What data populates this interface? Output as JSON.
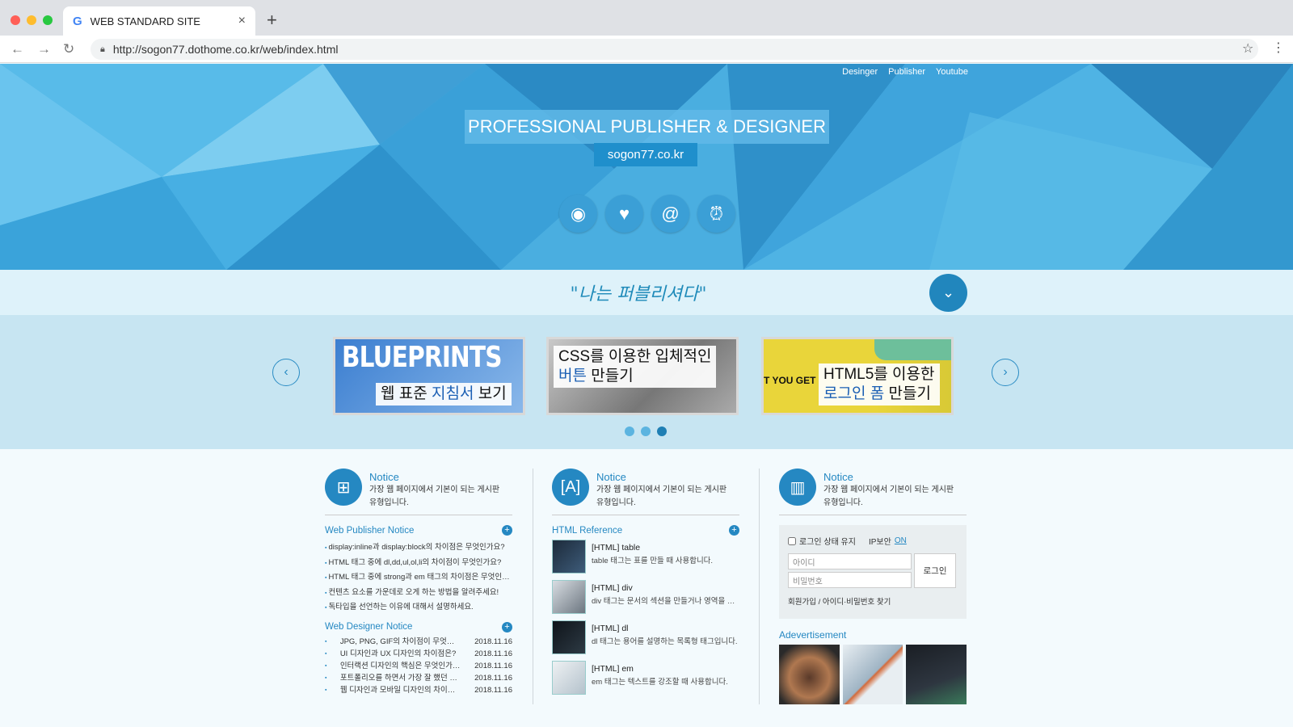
{
  "browser": {
    "tab_title": "WEB STANDARD SITE",
    "tab_icon": "G",
    "close": "×",
    "new_tab": "+",
    "url": "http://sogon77.dothome.co.kr/web/index.html"
  },
  "header": {
    "nav": [
      "Desinger",
      "Publisher",
      "Youtube"
    ],
    "headline": "PROFESSIONAL PUBLISHER & DESIGNER",
    "subline": "sogon77.co.kr",
    "icons": [
      "record-icon",
      "heart-icon",
      "at-icon",
      "alarm-clock-icon"
    ]
  },
  "quote": "\"나는 퍼블리셔다\"",
  "slider": {
    "slides": [
      {
        "big": "BLUEPRINTS",
        "line1": "웹 표준 ",
        "hl": "지침서",
        "line1b": " 보기"
      },
      {
        "line1": "CSS를 이용한 입체적인",
        "hl": "버튼",
        "line2b": " 만들기"
      },
      {
        "tag": "T YOU GET",
        "line1": "HTML5를 이용한",
        "hl": "로그인 폼",
        "line2b": " 만들기"
      }
    ],
    "dots": 3,
    "active_dot": 3
  },
  "columns": [
    {
      "title": "Notice",
      "desc": [
        "가장 웹 페이지에서 기본이 되는 게시판",
        "유형입니다."
      ],
      "sections": [
        {
          "title": "Web Publisher Notice",
          "items": [
            "display:inline과 display:block의 차이점은 무엇인가요?",
            "HTML 태그 중에 dl,dd,ul,ol,li의 차이점이 무엇인가요?",
            "HTML 태그 중에 strong과 em 태그의 차이점은 무엇인가요?",
            "컨텐츠 요소를 가운데로 오게 하는 방법을 알려주세요!",
            "독타입을 선언하는 이유에 대해서 설명하세요."
          ]
        },
        {
          "title": "Web Designer Notice",
          "items": [
            {
              "t": "JPG, PNG, GIF의 차이점이 무엇인가요?",
              "d": "2018.11.16"
            },
            {
              "t": "UI 디자인과 UX 디자인의 차이점은?",
              "d": "2018.11.16"
            },
            {
              "t": "인터랙션 디자인의 핵심은 무엇인가요?",
              "d": "2018.11.16"
            },
            {
              "t": "포트폴리오를 하면서 가장 잘 했던 점은?",
              "d": "2018.11.16"
            },
            {
              "t": "웹 디자인과 모바일 디자인의 차이점은?",
              "d": "2018.11.16"
            }
          ]
        }
      ]
    },
    {
      "title": "Notice",
      "desc": [
        "가장 웹 페이지에서 기본이 되는 게시판",
        "유형입니다."
      ],
      "section_title": "HTML Reference",
      "refs": [
        {
          "t": "[HTML] table",
          "d": "table 태그는 표를 만들 때 사용합니다."
        },
        {
          "t": "[HTML] div",
          "d": "div 태그는 문서의 섹션을 만들거나 영역을 나눌 때 사용합니다."
        },
        {
          "t": "[HTML] dl",
          "d": "dl 태그는 용어를 설명하는 목록형 태그입니다."
        },
        {
          "t": "[HTML] em",
          "d": "em 태그는 텍스트를 강조할 때 사용합니다."
        }
      ]
    },
    {
      "title": "Notice",
      "desc": [
        "가장 웹 페이지에서 기본이 되는 게시판",
        "유형입니다."
      ],
      "login": {
        "keep": "로그인 상태 유지",
        "ip": "IP보안",
        "on": "ON",
        "id_placeholder": "아이디",
        "pw_placeholder": "비밀번호",
        "button": "로그인",
        "footer": "회원가입 / 아이디·비밀번호 찾기"
      },
      "ad_title": "Adevertisement"
    }
  ],
  "colors": {
    "accent": "#2588c2",
    "hero": "#4aaee0"
  }
}
